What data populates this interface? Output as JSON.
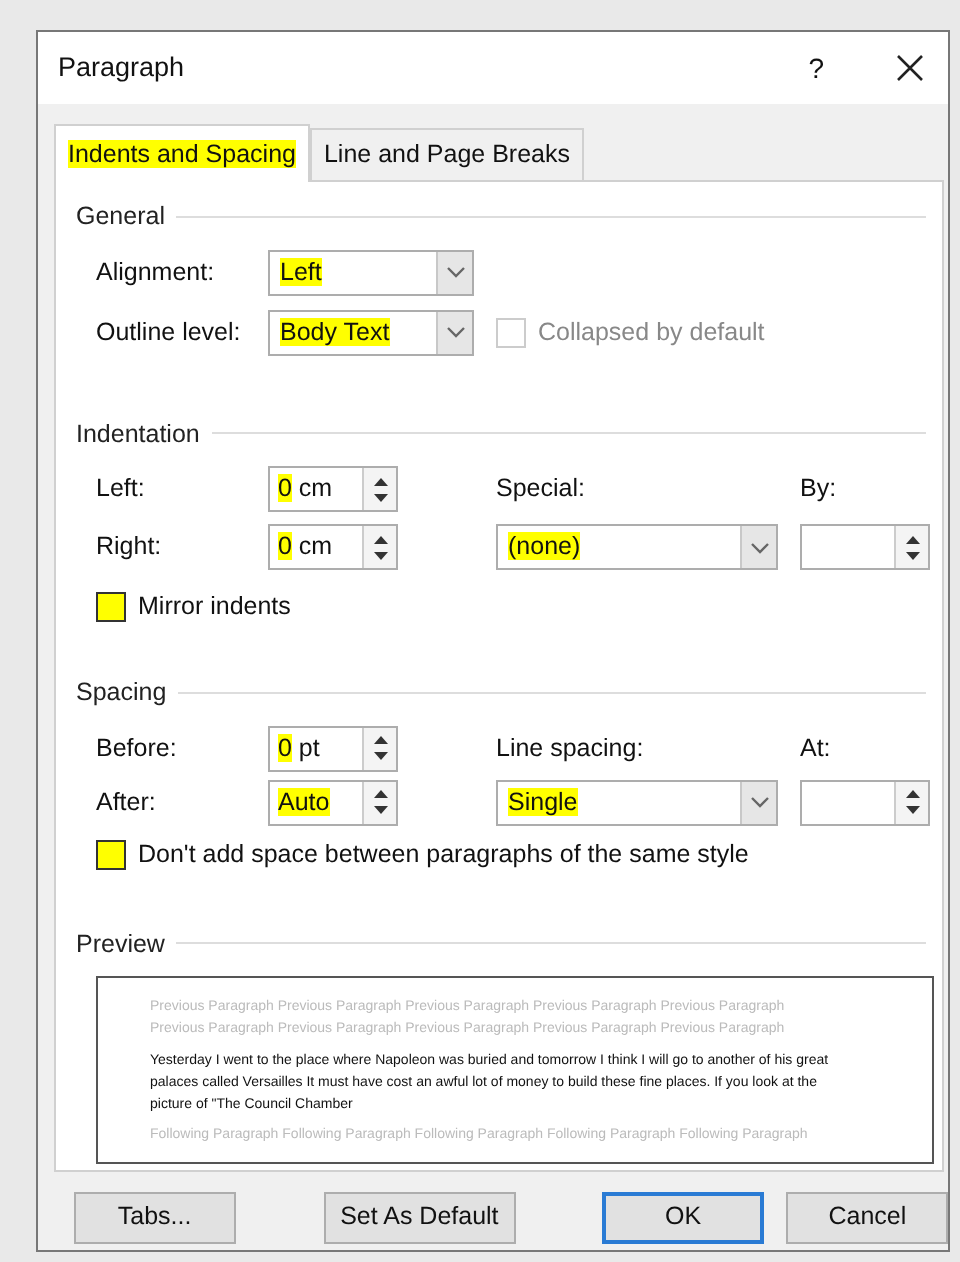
{
  "window": {
    "title": "Paragraph",
    "help": "?"
  },
  "tabs": [
    {
      "label": "Indents and Spacing",
      "selected": true,
      "highlighted": true
    },
    {
      "label": "Line and Page Breaks",
      "selected": false,
      "highlighted": false
    }
  ],
  "general": {
    "title": "General",
    "alignment": {
      "label": "Alignment:",
      "value": "Left",
      "highlighted": true
    },
    "outline_level": {
      "label": "Outline level:",
      "value": "Body Text",
      "highlighted": true
    },
    "collapsed_by_default": {
      "label": "Collapsed by default",
      "checked": false,
      "disabled": true,
      "highlighted": false
    }
  },
  "indentation": {
    "title": "Indentation",
    "left": {
      "label": "Left:",
      "value": "0",
      "unit": "cm",
      "highlighted": true
    },
    "right": {
      "label": "Right:",
      "value": "0",
      "unit": "cm",
      "highlighted": true
    },
    "special": {
      "label": "Special:",
      "value": "(none)",
      "highlighted": true
    },
    "by": {
      "label": "By:"
    },
    "mirror_indents": {
      "label": "Mirror indents",
      "checked": false,
      "disabled": false,
      "highlighted": true
    }
  },
  "spacing": {
    "title": "Spacing",
    "before": {
      "label": "Before:",
      "value": "0",
      "unit": "pt",
      "highlighted": true
    },
    "after": {
      "label": "After:",
      "value": "Auto",
      "highlighted": true
    },
    "line_spacing": {
      "label": "Line spacing:",
      "value": "Single",
      "highlighted": true
    },
    "at": {
      "label": "At:"
    },
    "dont_add_space": {
      "label": "Don't add space between paragraphs of the same style",
      "checked": false,
      "disabled": false,
      "highlighted": true
    }
  },
  "preview": {
    "title": "Preview",
    "previous_text": "Previous Paragraph Previous Paragraph Previous Paragraph Previous Paragraph Previous Paragraph Previous Paragraph Previous Paragraph Previous Paragraph Previous Paragraph Previous Paragraph",
    "sample_text": "Yesterday I went to the place where Napoleon was buried and tomorrow I think I will go to another of his great palaces called Versailles It must have cost an awful lot of money to build these fine places. If you look at the picture of \"The Council Chamber",
    "following_text": "Following Paragraph Following Paragraph Following Paragraph Following Paragraph Following Paragraph"
  },
  "buttons": [
    {
      "label": "Tabs...",
      "default": false
    },
    {
      "label": "Set As Default",
      "default": false
    },
    {
      "label": "OK",
      "default": true
    },
    {
      "label": "Cancel",
      "default": false
    }
  ]
}
